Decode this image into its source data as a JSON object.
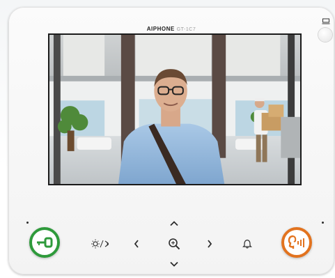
{
  "device": {
    "brand": "AIPHONE",
    "model": "GT-1C7"
  },
  "screen": {
    "content": "video-feed",
    "scene_elements": [
      "visitor",
      "delivery-worker",
      "lobby"
    ]
  },
  "controls": {
    "unlock": {
      "icon": "key-icon",
      "ring_color": "#2e9a3b"
    },
    "brightness_volume": {
      "icon": "brightness-icon"
    },
    "left": {
      "icon": "chevron-left-icon"
    },
    "zoom": {
      "icon": "zoom-icon"
    },
    "right": {
      "icon": "chevron-right-icon"
    },
    "up": {
      "icon": "chevron-up-icon"
    },
    "down": {
      "icon": "chevron-down-icon"
    },
    "chime": {
      "icon": "bell-icon"
    },
    "talk": {
      "icon": "talk-icon",
      "ring_color": "#e2731f"
    },
    "power": {
      "icon": "monitor-icon"
    }
  }
}
